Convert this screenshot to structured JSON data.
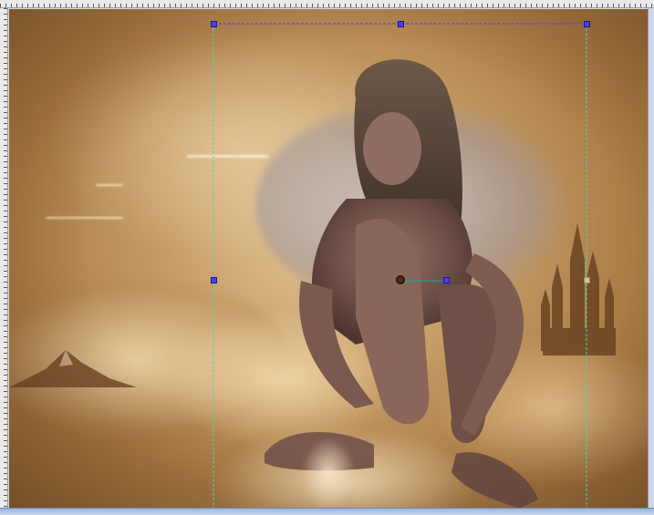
{
  "window": {
    "colors": {
      "ruler": "#e9e9e9",
      "scrollbar": "#b9c9e6",
      "selection": "#4b3cf0",
      "guide": "#4dd2c4"
    }
  },
  "canvas": {
    "tool": "deform",
    "icons": [
      "ruler-top",
      "ruler-left",
      "selection-handle",
      "rotation-pivot"
    ]
  }
}
